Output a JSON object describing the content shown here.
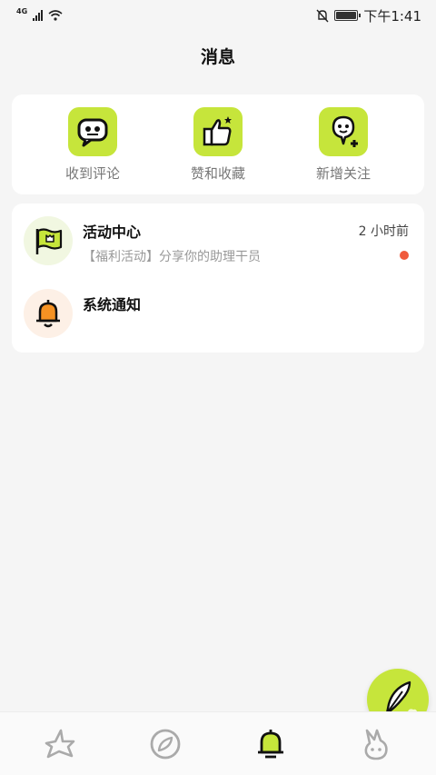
{
  "status_bar": {
    "network": "4G",
    "time": "下午1:41",
    "icons": [
      "signal-icon",
      "wifi-icon",
      "mute-bell-icon",
      "battery-icon"
    ]
  },
  "header": {
    "title": "消息"
  },
  "quick_actions": [
    {
      "label": "收到评论",
      "icon": "comment-bubble-icon"
    },
    {
      "label": "赞和收藏",
      "icon": "thumbs-up-icon"
    },
    {
      "label": "新增关注",
      "icon": "add-follower-icon"
    }
  ],
  "messages": [
    {
      "title": "活动中心",
      "time": "2 小时前",
      "preview": "【福利活动】分享你的助理干员",
      "unread": true,
      "icon": "flag-icon"
    },
    {
      "title": "系统通知",
      "time": "",
      "preview": "",
      "unread": false,
      "icon": "bell-icon"
    }
  ],
  "fab": {
    "icon": "feather-pen-icon"
  },
  "tabs": [
    {
      "name": "home",
      "icon": "home-wing-icon",
      "active": false
    },
    {
      "name": "discover",
      "icon": "compass-icon",
      "active": false
    },
    {
      "name": "messages",
      "icon": "bell-icon",
      "active": true
    },
    {
      "name": "profile",
      "icon": "bunny-icon",
      "active": false
    }
  ],
  "colors": {
    "accent": "#c6e53b",
    "unread": "#f05a3c",
    "background": "#f5f5f5"
  }
}
